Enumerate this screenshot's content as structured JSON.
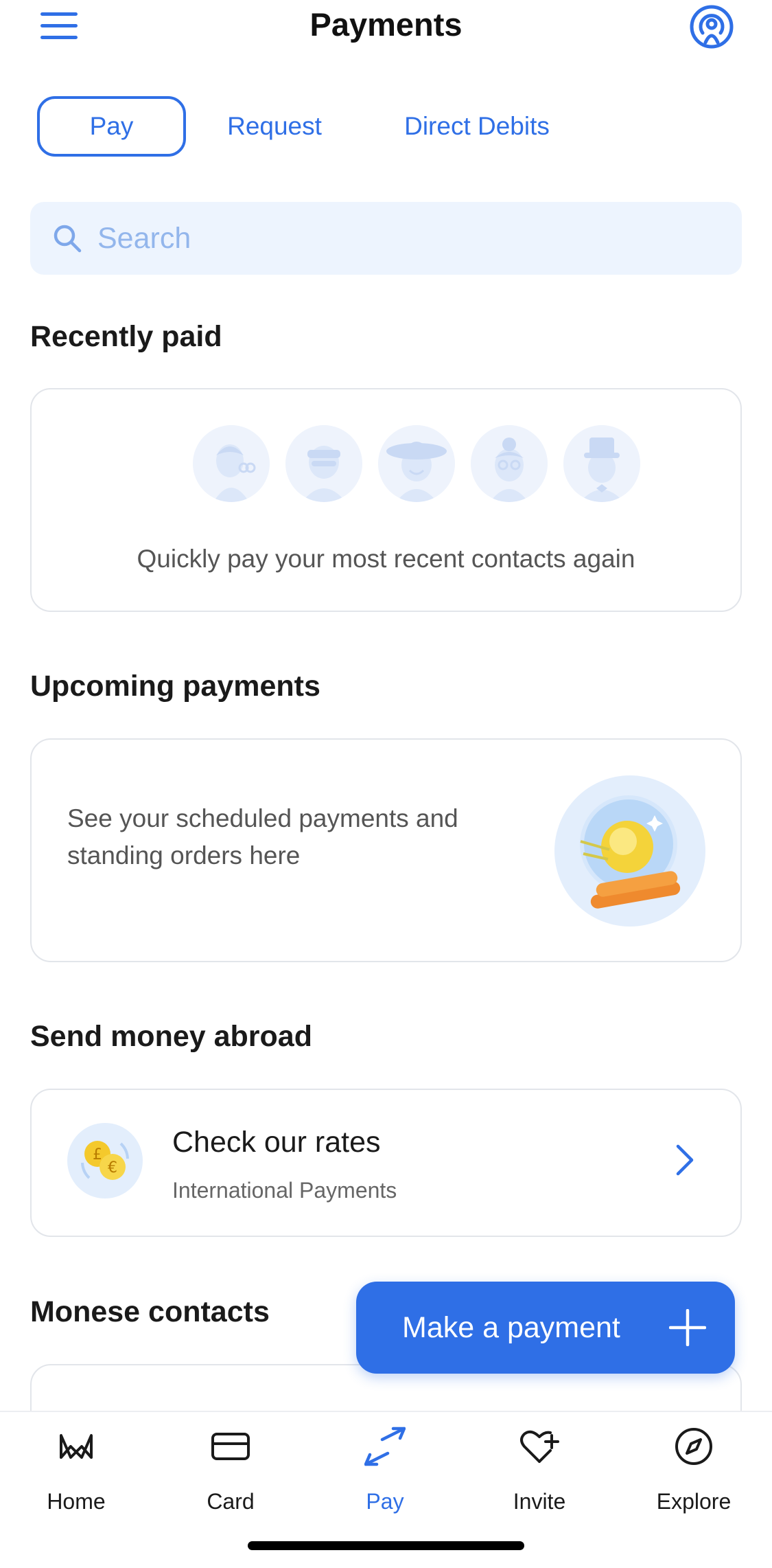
{
  "header": {
    "title": "Payments",
    "menu_icon": "hamburger-menu-icon",
    "support_icon": "support-signal-icon"
  },
  "tabs": [
    {
      "label": "Pay",
      "active": true
    },
    {
      "label": "Request",
      "active": false
    },
    {
      "label": "Direct Debits",
      "active": false
    }
  ],
  "search": {
    "placeholder": "Search",
    "icon": "search-icon"
  },
  "sections": {
    "recent": {
      "title": "Recently paid",
      "empty_text": "Quickly pay your most recent contacts again"
    },
    "upcoming": {
      "title": "Upcoming payments",
      "empty_text": "See your scheduled payments and standing orders here"
    },
    "abroad": {
      "title": "Send money abroad",
      "item_title": "Check our rates",
      "item_subtitle": "International Payments",
      "currency_symbols": [
        "£",
        "€"
      ]
    },
    "contacts": {
      "title": "Monese contacts"
    }
  },
  "fab": {
    "label": "Make a payment",
    "icon": "plus-icon"
  },
  "tabbar": [
    {
      "label": "Home",
      "icon": "monese-logo-icon",
      "active": false
    },
    {
      "label": "Card",
      "icon": "card-icon",
      "active": false
    },
    {
      "label": "Pay",
      "icon": "transfer-arrows-icon",
      "active": true
    },
    {
      "label": "Invite",
      "icon": "heart-plus-icon",
      "active": false
    },
    {
      "label": "Explore",
      "icon": "compass-icon",
      "active": false
    }
  ],
  "colors": {
    "accent": "#2f6fe6",
    "search_bg": "#edf4fe",
    "card_border": "#e2e5ea",
    "muted_text": "#555555"
  }
}
